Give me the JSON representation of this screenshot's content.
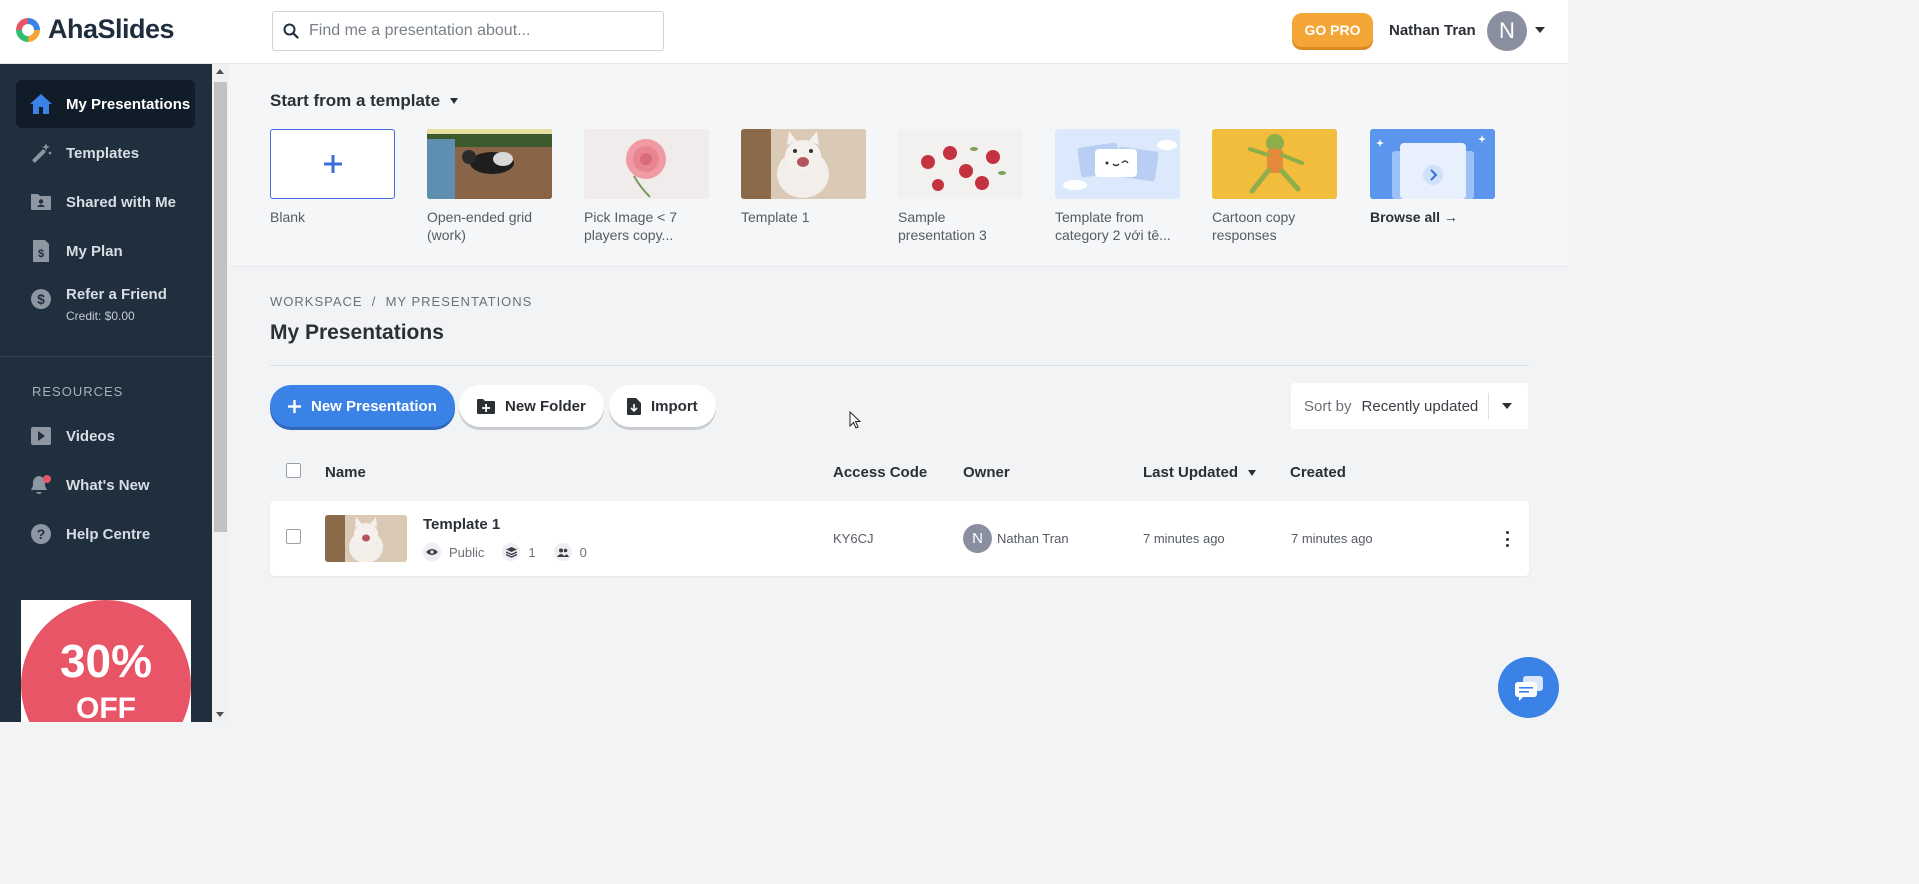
{
  "header": {
    "app_name": "AhaSlides",
    "search_placeholder": "Find me a presentation about...",
    "go_pro": "GO PRO",
    "user_name": "Nathan Tran",
    "avatar_initial": "N"
  },
  "sidebar": {
    "items": [
      {
        "label": "My Presentations",
        "icon": "home-icon",
        "active": true
      },
      {
        "label": "Templates",
        "icon": "magic-wand-icon"
      },
      {
        "label": "Shared with Me",
        "icon": "shared-folder-icon"
      },
      {
        "label": "My Plan",
        "icon": "receipt-icon"
      },
      {
        "label": "Refer a Friend",
        "sub": "Credit: $0.00",
        "icon": "dollar-icon"
      }
    ],
    "resources_label": "RESOURCES",
    "resources": [
      {
        "label": "Videos",
        "icon": "video-icon"
      },
      {
        "label": "What's New",
        "icon": "bell-icon"
      },
      {
        "label": "Help Centre",
        "icon": "help-icon"
      }
    ],
    "promo": {
      "percent": "30%",
      "off": "OFF"
    }
  },
  "templates": {
    "title": "Start from a template",
    "items": [
      {
        "label": "Blank"
      },
      {
        "label": "Open-ended grid (work)"
      },
      {
        "label": "Pick Image < 7 players copy..."
      },
      {
        "label": "Template 1"
      },
      {
        "label": "Sample presentation 3"
      },
      {
        "label": "Template from category 2 với tê..."
      },
      {
        "label": "Cartoon copy responses"
      },
      {
        "label": "Browse all →"
      }
    ]
  },
  "main": {
    "breadcrumb": "WORKSPACE  /  MY PRESENTATIONS",
    "title": "My Presentations",
    "buttons": {
      "new_presentation": "New Presentation",
      "new_folder": "New Folder",
      "import": "Import"
    },
    "sort": {
      "label": "Sort by",
      "value": "Recently updated"
    },
    "table": {
      "headers": {
        "name": "Name",
        "access_code": "Access Code",
        "owner": "Owner",
        "last_updated": "Last Updated",
        "created": "Created"
      },
      "rows": [
        {
          "title": "Template 1",
          "visibility": "Public",
          "slides": "1",
          "participants": "0",
          "access_code": "KY6CJ",
          "owner_initial": "N",
          "owner": "Nathan Tran",
          "last_updated": "7 minutes ago",
          "created": "7 minutes ago"
        }
      ]
    }
  },
  "colors": {
    "sidebar_bg": "#1f2f3e",
    "primary": "#3b82e6",
    "go_pro": "#f3a535",
    "promo": "#e85566"
  }
}
